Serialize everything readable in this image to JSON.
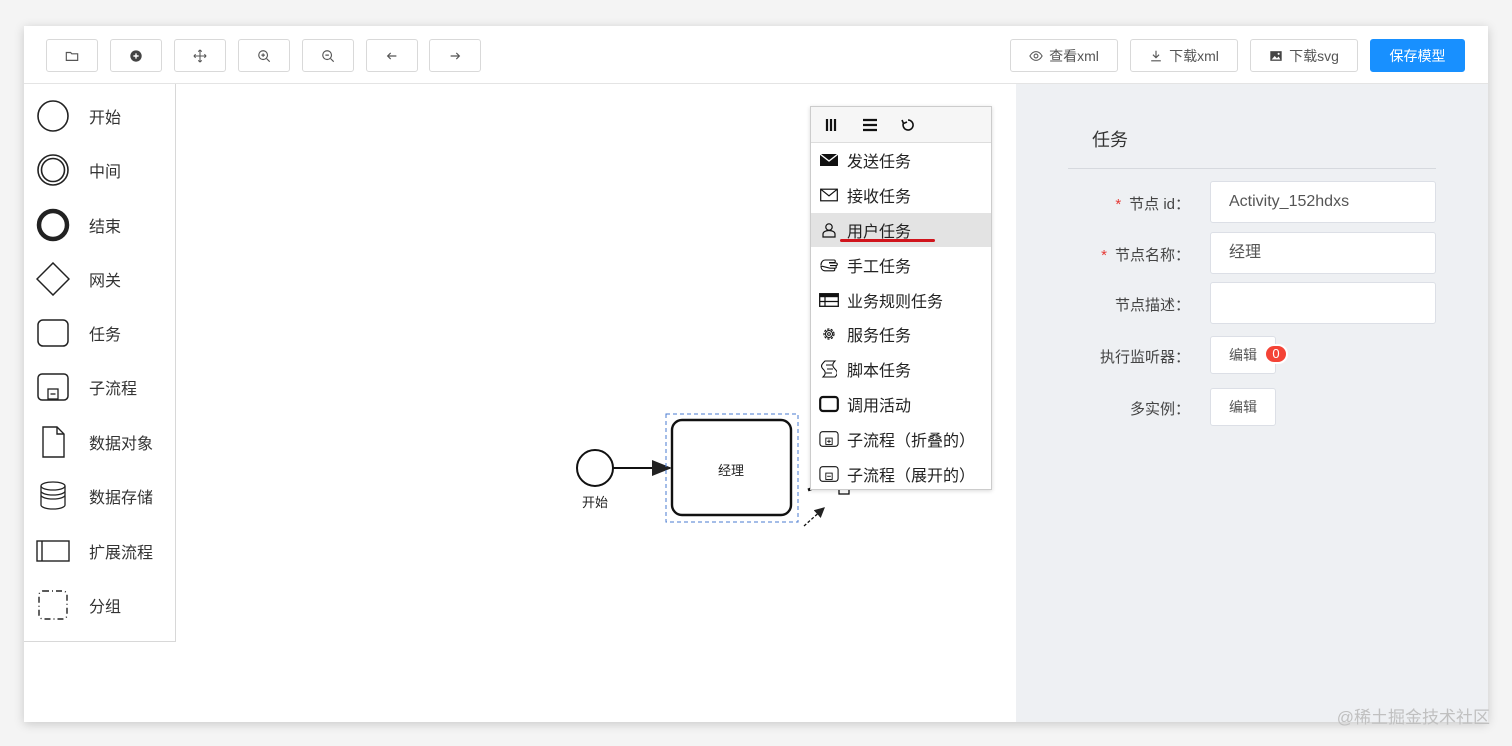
{
  "toolbar": {
    "icon_buttons": [
      {
        "name": "open-file-button",
        "icon": "folder-icon"
      },
      {
        "name": "create-new-button",
        "icon": "plus-circle-icon"
      },
      {
        "name": "move-button",
        "icon": "move-arrows-icon"
      },
      {
        "name": "zoom-in-button",
        "icon": "zoom-in-icon"
      },
      {
        "name": "zoom-out-button",
        "icon": "zoom-out-icon"
      },
      {
        "name": "undo-button",
        "icon": "arrow-left-icon"
      },
      {
        "name": "redo-button",
        "icon": "arrow-right-icon"
      }
    ],
    "view_xml": "查看xml",
    "download_xml": "下载xml",
    "download_svg": "下载svg",
    "save_model": "保存模型",
    "primary_color": "#1890ff"
  },
  "palette": {
    "items": [
      {
        "label": "开始",
        "icon": "start-event-icon"
      },
      {
        "label": "中间",
        "icon": "intermediate-event-icon"
      },
      {
        "label": "结束",
        "icon": "end-event-icon"
      },
      {
        "label": "网关",
        "icon": "gateway-icon"
      },
      {
        "label": "任务",
        "icon": "task-icon"
      },
      {
        "label": "子流程",
        "icon": "subprocess-icon"
      },
      {
        "label": "数据对象",
        "icon": "data-object-icon"
      },
      {
        "label": "数据存储",
        "icon": "data-store-icon"
      },
      {
        "label": "扩展流程",
        "icon": "pool-icon"
      },
      {
        "label": "分组",
        "icon": "group-icon"
      }
    ]
  },
  "canvas": {
    "start_label": "开始",
    "task_label": "经理"
  },
  "context_menu": {
    "header_icons": [
      "columns-icon",
      "list-icon",
      "reset-icon"
    ],
    "items": [
      {
        "label": "发送任务",
        "icon": "send-envelope-icon"
      },
      {
        "label": "接收任务",
        "icon": "receive-envelope-icon"
      },
      {
        "label": "用户任务",
        "icon": "user-icon",
        "active": true
      },
      {
        "label": "手工任务",
        "icon": "hand-icon"
      },
      {
        "label": "业务规则任务",
        "icon": "table-icon"
      },
      {
        "label": "服务任务",
        "icon": "gear-icon"
      },
      {
        "label": "脚本任务",
        "icon": "script-icon"
      },
      {
        "label": "调用活动",
        "icon": "call-activity-icon"
      },
      {
        "label": "子流程（折叠的）",
        "icon": "collapsed-subprocess-icon"
      },
      {
        "label": "子流程（展开的）",
        "icon": "expanded-subprocess-icon"
      }
    ]
  },
  "panel": {
    "title": "任务",
    "fields": {
      "node_id_label": "节点 id：",
      "node_id_value": "Activity_152hdxs",
      "node_name_label": "节点名称：",
      "node_name_value": "经理",
      "node_desc_label": "节点描述：",
      "node_desc_value": "",
      "listener_label": "执行监听器：",
      "listener_button": "编辑",
      "listener_count": "0",
      "multi_instance_label": "多实例：",
      "multi_instance_button": "编辑"
    }
  },
  "watermark": "@稀土掘金技术社区"
}
